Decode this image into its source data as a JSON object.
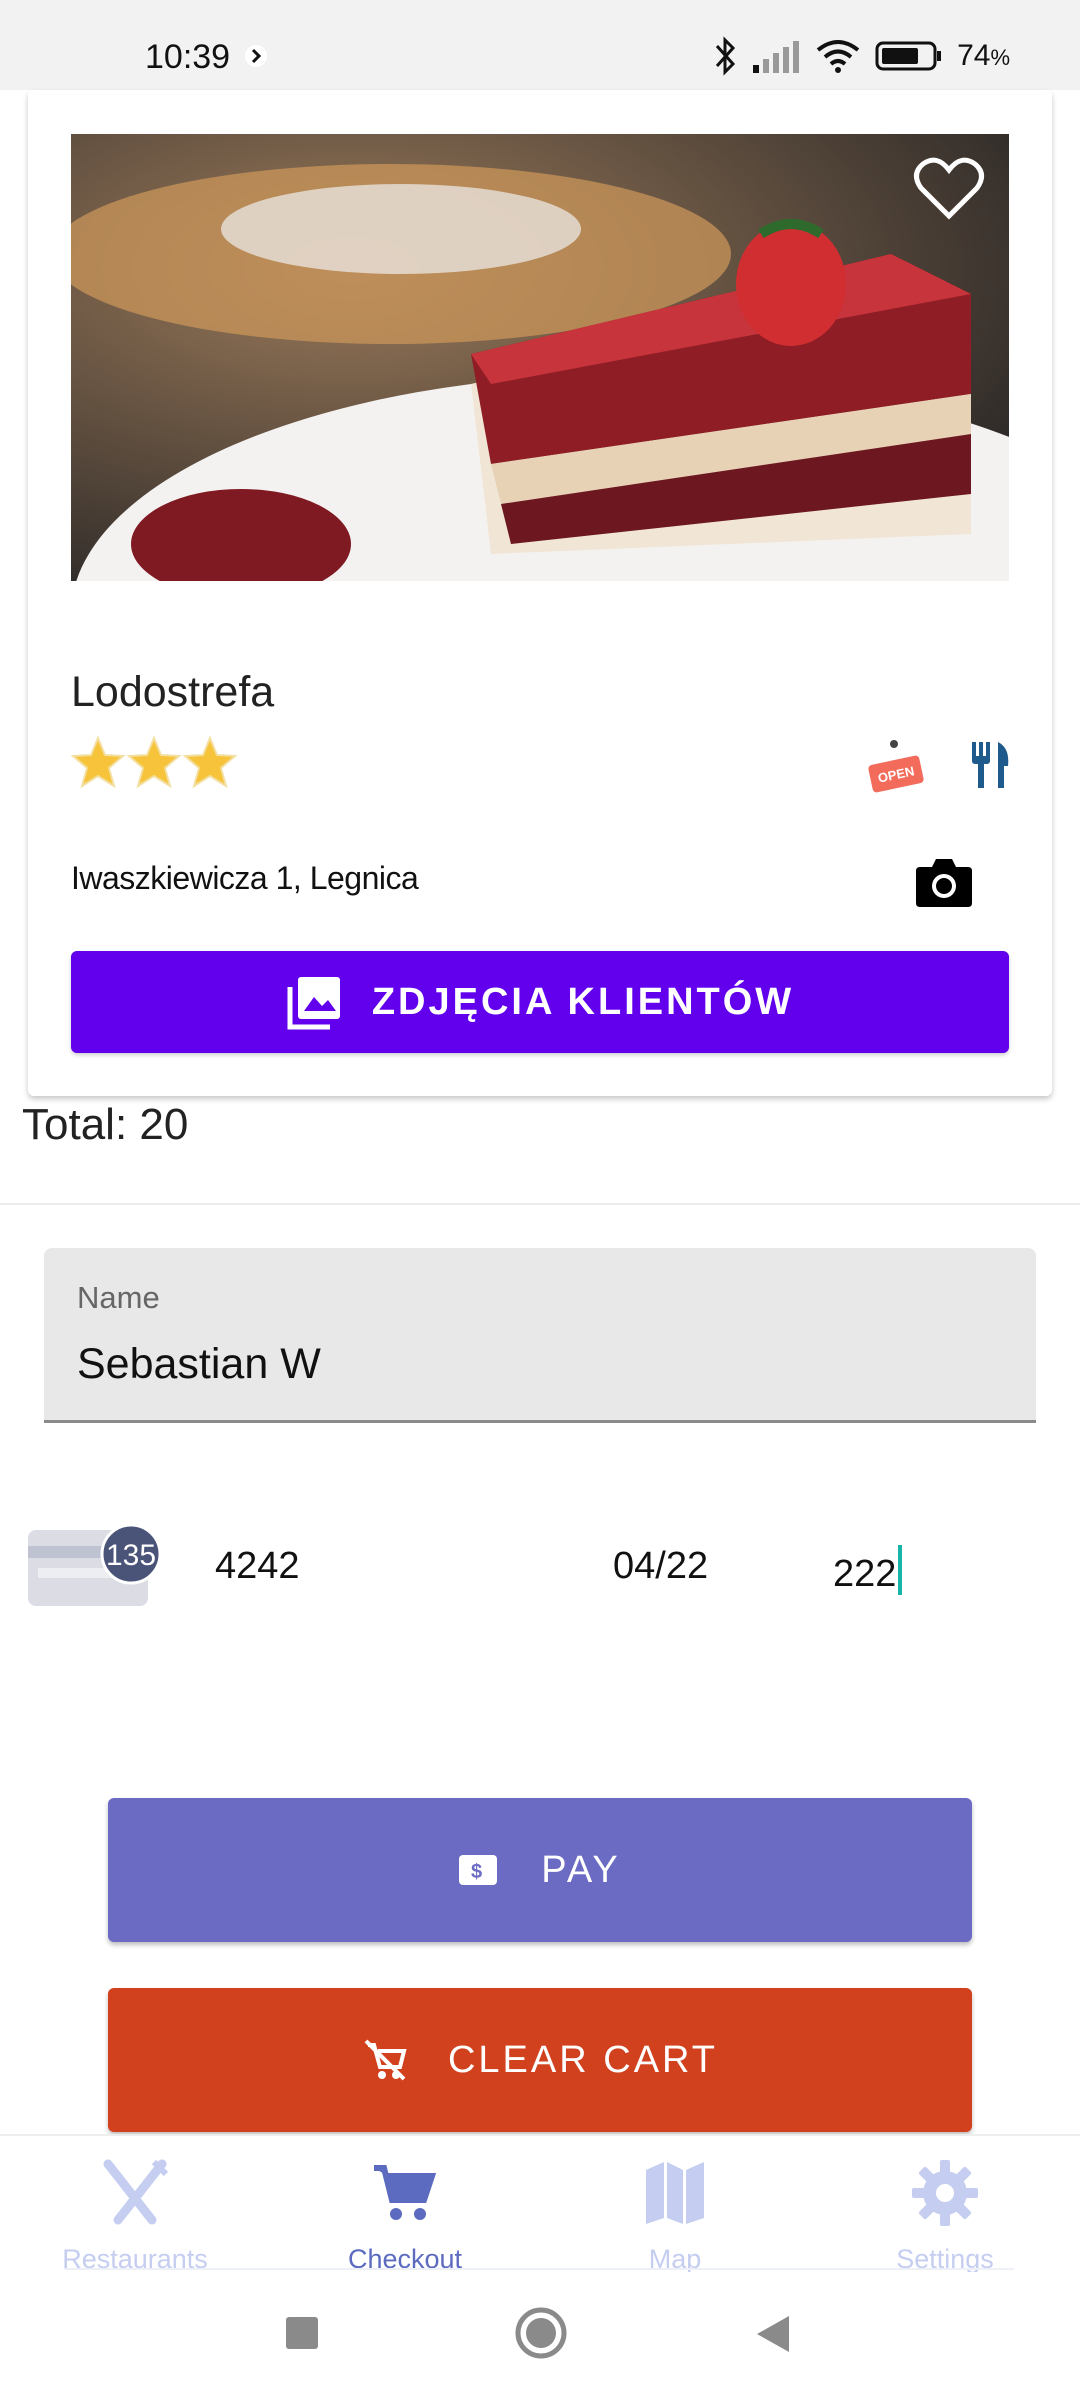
{
  "status_bar": {
    "time": "10:39",
    "battery_percent": "74",
    "battery_unit": "%",
    "battery_level": 0.74
  },
  "restaurant": {
    "name": "Lodostrefa",
    "rating_stars": 3,
    "address": "Iwaszkiewicza 1, Legnica",
    "open_badge": "OPEN",
    "photos_button_label": "ZDJĘCIA KLIENTÓW",
    "favorite_icon": "heart-outline-icon",
    "photo_subject": "red velvet cake with strawberry"
  },
  "order": {
    "total_text": "Total: 20"
  },
  "form": {
    "name_label": "Name",
    "name_value": "Sebastian W",
    "card_badge": "135",
    "card_number": "4242",
    "card_expiry": "04/22",
    "card_cvc": "222"
  },
  "actions": {
    "pay_label": "PAY",
    "clear_label": "CLEAR CART"
  },
  "bottom_nav": {
    "items": [
      {
        "label": "Restaurants",
        "icon": "fork-knife-icon",
        "active": false
      },
      {
        "label": "Checkout",
        "icon": "cart-icon",
        "active": true
      },
      {
        "label": "Map",
        "icon": "map-icon",
        "active": false
      },
      {
        "label": "Settings",
        "icon": "gear-icon",
        "active": false
      }
    ]
  },
  "colors": {
    "primary_purple": "#6200ee",
    "pay_button": "#6b6bc4",
    "clear_button": "#d2411e",
    "nav_active": "#5c6bc0",
    "nav_inactive": "#c5cdf0"
  }
}
